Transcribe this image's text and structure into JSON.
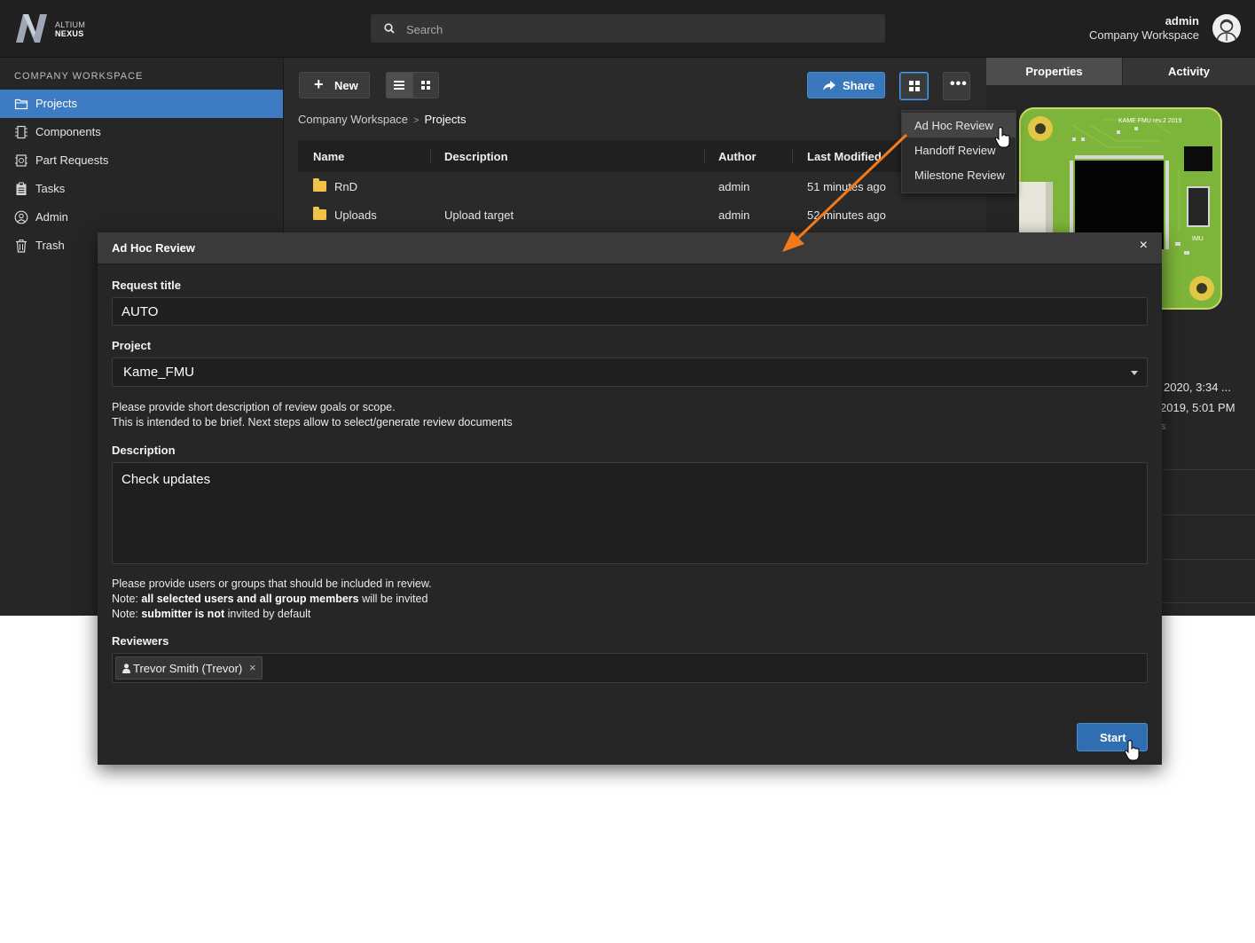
{
  "app": {
    "logo_top": "ALTIUM",
    "logo_bottom": "NEXUS",
    "search_placeholder": "Search",
    "user_name": "admin",
    "user_workspace": "Company Workspace"
  },
  "sidebar": {
    "heading": "COMPANY WORKSPACE",
    "items": [
      {
        "label": "Projects",
        "icon": "folder-icon",
        "active": true
      },
      {
        "label": "Components",
        "icon": "component-icon"
      },
      {
        "label": "Part Requests",
        "icon": "part-request-icon"
      },
      {
        "label": "Tasks",
        "icon": "clipboard-icon"
      },
      {
        "label": "Admin",
        "icon": "user-circle-icon"
      },
      {
        "label": "Trash",
        "icon": "trash-icon"
      }
    ]
  },
  "toolbar": {
    "new_label": "New",
    "share_label": "Share"
  },
  "breadcrumb": {
    "root": "Company Workspace",
    "current": "Projects"
  },
  "table": {
    "headers": [
      "Name",
      "Description",
      "Author",
      "Last Modified"
    ],
    "rows": [
      {
        "name": "RnD",
        "description": "",
        "author": "admin",
        "modified": "51 minutes ago"
      },
      {
        "name": "Uploads",
        "description": "Upload target",
        "author": "admin",
        "modified": "52 minutes ago"
      }
    ]
  },
  "review_menu": {
    "items": [
      "Ad Hoc Review",
      "Handoff Review",
      "Milestone Review"
    ]
  },
  "right_panel": {
    "tabs": [
      "Properties",
      "Activity"
    ],
    "pcb_label_top": "KAME FMU rev.2 2019",
    "pcb_label_imu": "IMU",
    "date1": "2020, 3:34 ...",
    "date2": "2019, 5:01 PM",
    "link_fragment": "s"
  },
  "modal": {
    "title": "Ad Hoc Review",
    "close_glyph": "×",
    "request_title_label": "Request title",
    "request_title_value": "AUTO",
    "project_label": "Project",
    "project_value": "Kame_FMU",
    "help1_line1": "Please provide short description of review goals or scope.",
    "help1_line2": "This is intended to be brief. Next steps allow to select/generate review documents",
    "description_label": "Description",
    "description_value": "Check updates",
    "help2_line1": "Please provide users or groups that should be included in review.",
    "help2_note_prefix": "Note: ",
    "help2_line2_bold": "all selected users and all group members",
    "help2_line2_rest": " will be invited",
    "help2_line3_bold": "submitter is not",
    "help2_line3_rest": " invited by default",
    "reviewers_label": "Reviewers",
    "reviewer_chip": "Trevor Smith (Trevor)",
    "chip_remove": "×",
    "start_label": "Start"
  },
  "colors": {
    "accent": "#3d7cc2",
    "annotation_arrow": "#f07a1c",
    "folder": "#f2c34b",
    "pcb_green": "#7db43a"
  }
}
